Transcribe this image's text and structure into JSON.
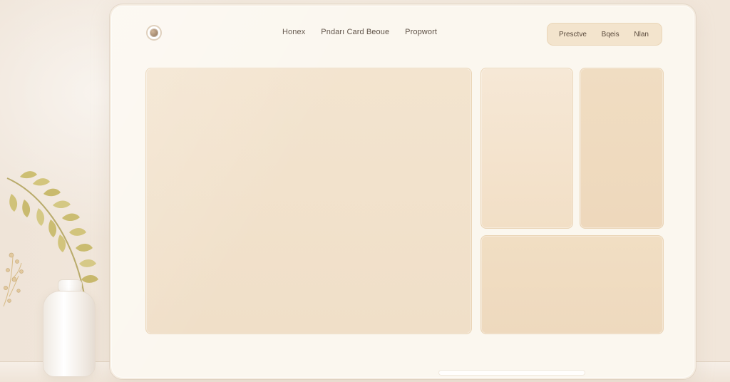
{
  "nav": {
    "items": [
      {
        "label": "Honex"
      },
      {
        "label": "Pndarı Card Beoue"
      },
      {
        "label": "Propwort"
      }
    ]
  },
  "actions": {
    "items": [
      {
        "label": "Presctve"
      },
      {
        "label": "Bqeis"
      },
      {
        "label": "Nlan"
      }
    ]
  },
  "colors": {
    "background": "#f2e7dc",
    "screen": "#fbf7ef",
    "panel": "#f1e1c9",
    "accent": "#f3e4cd",
    "text": "#5e5146"
  },
  "icons": {
    "logo": "logo-icon"
  }
}
